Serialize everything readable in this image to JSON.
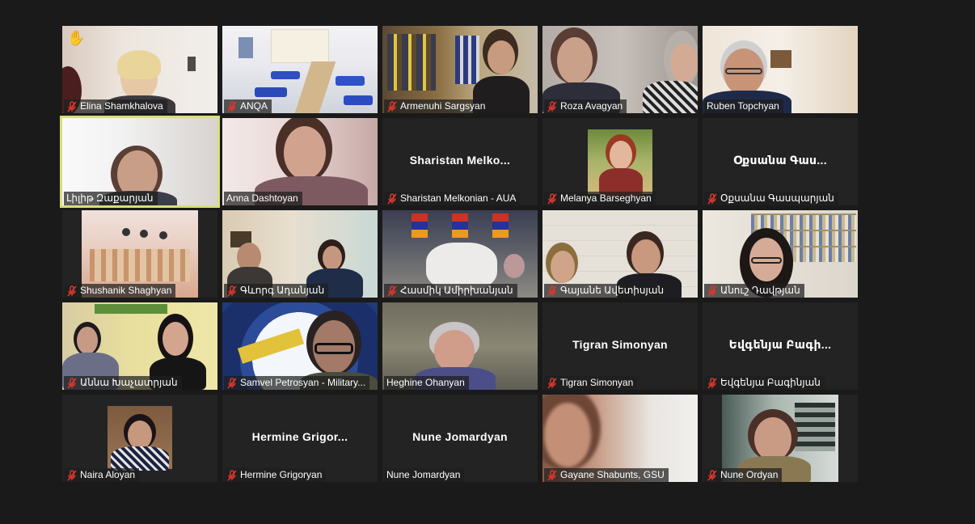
{
  "participants": [
    {
      "name": "Elina Shamkhalova",
      "muted": true,
      "hand_raised": true,
      "video": true
    },
    {
      "name": "ANQA",
      "muted": true,
      "video": true
    },
    {
      "name": "Armenuhi Sargsyan",
      "muted": true,
      "video": true
    },
    {
      "name": "Roza Avagyan",
      "muted": true,
      "video": true
    },
    {
      "name": "Ruben Topchyan",
      "muted": false,
      "video": true
    },
    {
      "name": "Լիլիթ Զաքարյան",
      "muted": false,
      "video": true,
      "active_speaker": true
    },
    {
      "name": "Anna Dashtoyan",
      "muted": false,
      "video": true
    },
    {
      "name": "Sharistan Melkonian - AUA",
      "placeholder": "Sharistan  Melko...",
      "muted": true,
      "video": false
    },
    {
      "name": "Melanya Barseghyan",
      "muted": true,
      "video": true
    },
    {
      "name": "Օքսանա Գասպարյան",
      "placeholder": "Օքսանա  Գաս...",
      "muted": true,
      "video": false
    },
    {
      "name": "Shushanik Shaghyan",
      "muted": true,
      "video": true
    },
    {
      "name": "Գևորգ Ադանյան",
      "muted": true,
      "video": true
    },
    {
      "name": "Հասմիկ Ամիրխանյան",
      "muted": true,
      "video": true
    },
    {
      "name": "Գայանե Ավետիսյան",
      "muted": true,
      "video": true
    },
    {
      "name": "Անուշ Դավթյան",
      "muted": true,
      "video": true
    },
    {
      "name": "Աննա Խաչատրյան",
      "muted": true,
      "video": true
    },
    {
      "name": "Samvel Petrosyan - Military...",
      "muted": true,
      "video": true
    },
    {
      "name": "Heghine Ohanyan",
      "muted": false,
      "video": true
    },
    {
      "name": "Tigran Simonyan",
      "placeholder": "Tigran Simonyan",
      "muted": true,
      "video": false
    },
    {
      "name": "Եվգենյա Բագինյան",
      "placeholder": "Եվգենյա Բագի...",
      "muted": true,
      "video": false
    },
    {
      "name": "Naira Aloyan",
      "muted": true,
      "video": true
    },
    {
      "name": "Hermine Grigoryan",
      "placeholder": "Hermine  Grigor...",
      "muted": true,
      "video": false
    },
    {
      "name": "Nune Jomardyan",
      "placeholder": "Nune Jomardyan",
      "muted": false,
      "video": false
    },
    {
      "name": "Gayane Shabunts, GSU",
      "muted": true,
      "video": true
    },
    {
      "name": "Nune Ordyan",
      "muted": true,
      "video": true
    }
  ],
  "colors": {
    "background": "#1a1a1a",
    "tile_background": "#232323",
    "active_speaker_border": "#d9dd7c",
    "muted_icon": "#e0362c"
  },
  "icons": {
    "muted": "mic-muted-icon",
    "hand": "raised-hand-icon"
  }
}
